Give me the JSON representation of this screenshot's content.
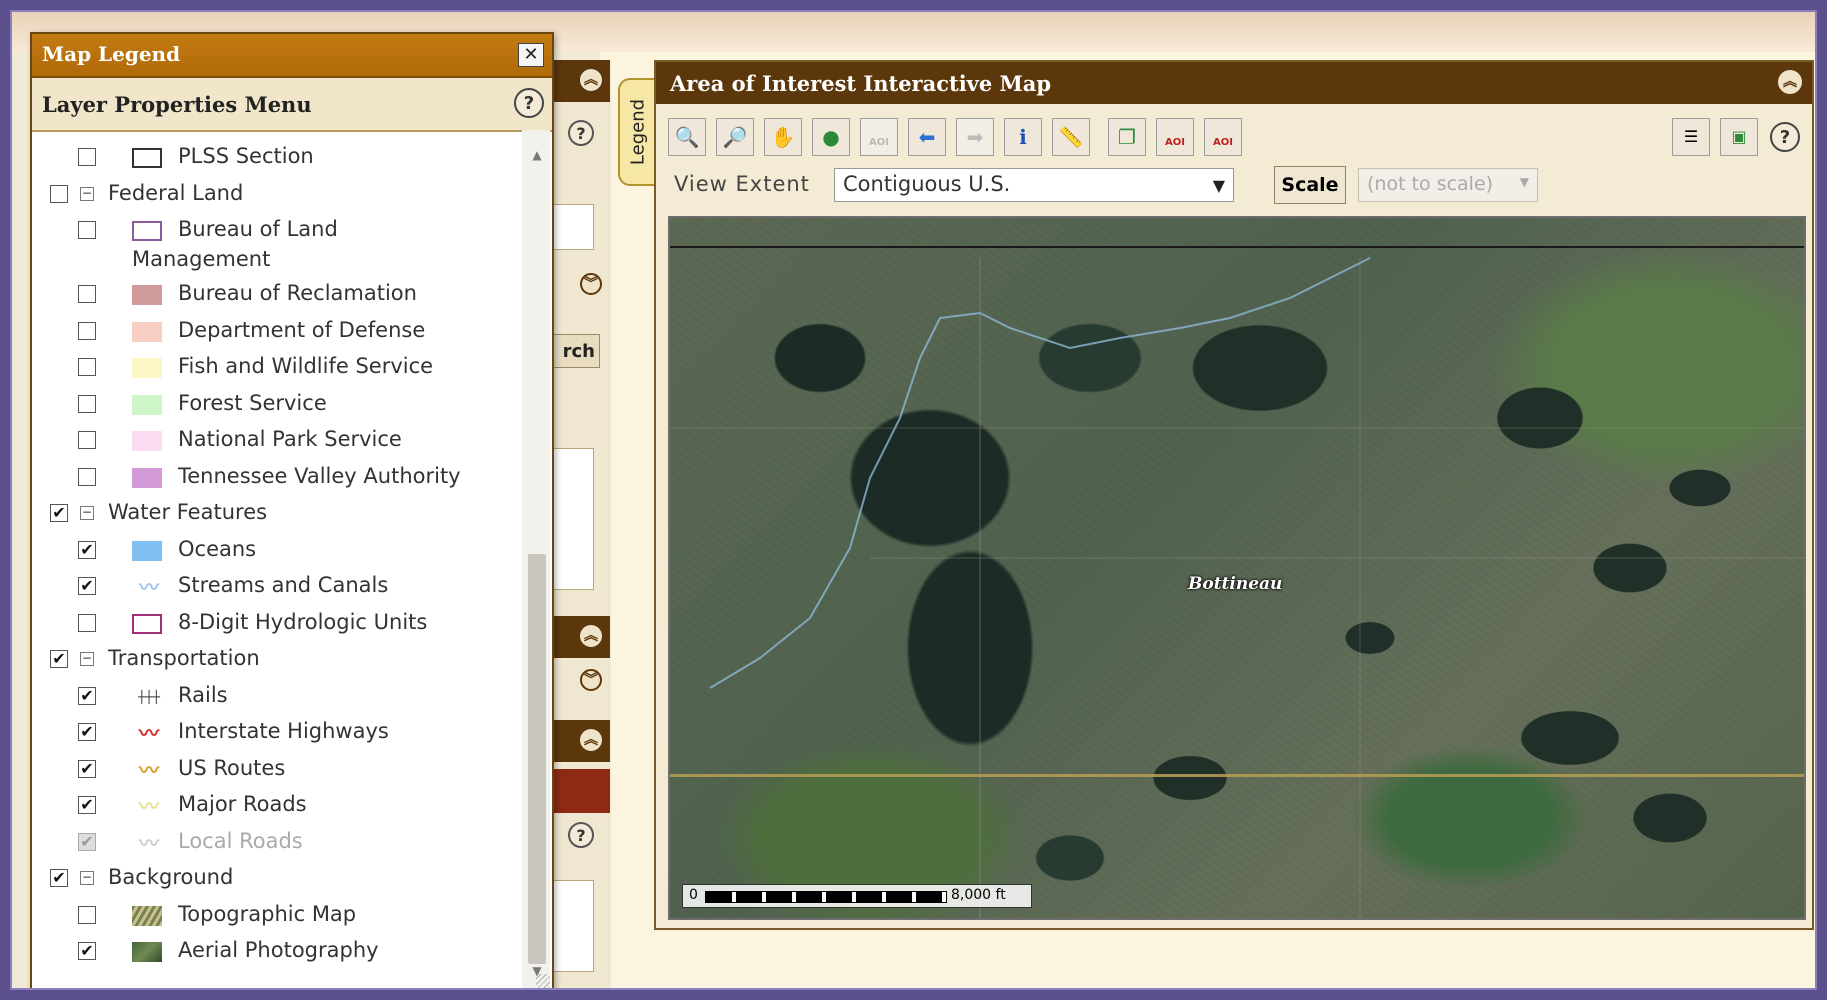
{
  "legend_window": {
    "title": "Map Legend",
    "close_symbol": "✕",
    "menu_title": "Layer Properties Menu",
    "help_symbol": "?"
  },
  "legend_tab": {
    "label": "Legend"
  },
  "layers": [
    {
      "label": "PLSS Section",
      "level": 1,
      "checked": false,
      "symbol": "outline-box"
    },
    {
      "label": "Federal Land",
      "level": 0,
      "checked": false,
      "group": true
    },
    {
      "label": "Bureau of Land",
      "label2": "Management",
      "level": 1,
      "checked": false,
      "symbol": "outline-purple"
    },
    {
      "label": "Bureau of Reclamation",
      "level": 1,
      "checked": false,
      "symbol": "swatch",
      "color": "#d19a9a"
    },
    {
      "label": "Department of Defense",
      "level": 1,
      "checked": false,
      "symbol": "swatch",
      "color": "#f9cfc4"
    },
    {
      "label": "Fish and Wildlife Service",
      "level": 1,
      "checked": false,
      "symbol": "swatch",
      "color": "#fdf6c5"
    },
    {
      "label": "Forest Service",
      "level": 1,
      "checked": false,
      "symbol": "swatch",
      "color": "#cdf5c8"
    },
    {
      "label": "National Park Service",
      "level": 1,
      "checked": false,
      "symbol": "swatch",
      "color": "#fbdcf0"
    },
    {
      "label": "Tennessee Valley Authority",
      "level": 1,
      "checked": false,
      "symbol": "swatch",
      "color": "#d39ad8"
    },
    {
      "label": "Water Features",
      "level": 0,
      "checked": true,
      "group": true
    },
    {
      "label": "Oceans",
      "level": 1,
      "checked": true,
      "symbol": "swatch",
      "color": "#7fbff2"
    },
    {
      "label": "Streams and Canals",
      "level": 1,
      "checked": true,
      "symbol": "stream-line"
    },
    {
      "label": "8-Digit Hydrologic Units",
      "level": 1,
      "checked": false,
      "symbol": "outline-magenta"
    },
    {
      "label": "Transportation",
      "level": 0,
      "checked": true,
      "group": true
    },
    {
      "label": "Rails",
      "level": 1,
      "checked": true,
      "symbol": "rails"
    },
    {
      "label": "Interstate Highways",
      "level": 1,
      "checked": true,
      "symbol": "interstate-line"
    },
    {
      "label": "US Routes",
      "level": 1,
      "checked": true,
      "symbol": "us-route-line"
    },
    {
      "label": "Major Roads",
      "level": 1,
      "checked": true,
      "symbol": "major-road-line"
    },
    {
      "label": "Local Roads",
      "level": 1,
      "checked": true,
      "disabled": true,
      "symbol": "local-road-line"
    },
    {
      "label": "Background",
      "level": 0,
      "checked": true,
      "group": true
    },
    {
      "label": "Topographic Map",
      "level": 1,
      "checked": false,
      "symbol": "topo-swatch"
    },
    {
      "label": "Aerial Photography",
      "level": 1,
      "checked": true,
      "symbol": "aerial-swatch"
    }
  ],
  "map_panel": {
    "title": "Area of Interest Interactive Map",
    "view_extent_label": "View Extent",
    "view_extent_value": "Contiguous U.S.",
    "scale_button": "Scale",
    "scale_value": "(not to scale)",
    "place_label": "Bottineau",
    "scalebar_start": "0",
    "scalebar_end": "8,000 ft",
    "aoi_text": "AOI"
  },
  "side_button_text": "rch",
  "colors": {
    "title_bar": "#5c370c",
    "legend_title_bar": "#b8700c",
    "accent_panel": "#f3ebd3"
  }
}
